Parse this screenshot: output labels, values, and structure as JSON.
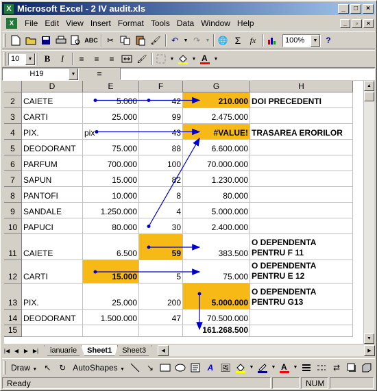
{
  "window": {
    "title": "Microsoft Excel - 2 IV audit.xls",
    "app_icon": "X"
  },
  "menu": [
    "File",
    "Edit",
    "View",
    "Insert",
    "Format",
    "Tools",
    "Data",
    "Window",
    "Help"
  ],
  "toolbar_standard": {
    "zoom": "100%",
    "icons": [
      "new-icon",
      "open-icon",
      "save-icon",
      "print-icon",
      "print-preview-icon",
      "spelling-icon",
      "cut-icon",
      "copy-icon",
      "paste-icon",
      "format-painter-icon",
      "undo-icon",
      "redo-icon",
      "hyperlink-icon",
      "autosum-icon",
      "function-icon",
      "chart-wizard-icon"
    ]
  },
  "toolbar_formatting": {
    "font_size": "10",
    "bold": "B",
    "italic": "I"
  },
  "formula_bar": {
    "name_box": "H19",
    "equals": "=",
    "content": ""
  },
  "grid": {
    "columns": [
      {
        "key": "D",
        "label": "D"
      },
      {
        "key": "E",
        "label": "E"
      },
      {
        "key": "F",
        "label": "F"
      },
      {
        "key": "G",
        "label": "G"
      },
      {
        "key": "H",
        "label": "H"
      }
    ],
    "rows": [
      {
        "num": "2",
        "D": "CAIETE",
        "E": "5.000",
        "F": "42",
        "G": "210.000",
        "H": "DOI PRECEDENTI"
      },
      {
        "num": "3",
        "D": "CARTI",
        "E": "25.000",
        "F": "99",
        "G": "2.475.000",
        "H": ""
      },
      {
        "num": "4",
        "D": "PIX.",
        "E": "pix",
        "F": "43",
        "G": "#VALUE!",
        "H": "TRASAREA ERORILOR"
      },
      {
        "num": "5",
        "D": "DEODORANT",
        "E": "75.000",
        "F": "88",
        "G": "6.600.000",
        "H": ""
      },
      {
        "num": "6",
        "D": "PARFUM",
        "E": "700.000",
        "F": "100",
        "G": "70.000.000",
        "H": ""
      },
      {
        "num": "7",
        "D": "SAPUN",
        "E": "15.000",
        "F": "82",
        "G": "1.230.000",
        "H": ""
      },
      {
        "num": "8",
        "D": "PANTOFI",
        "E": "10.000",
        "F": "8",
        "G": "80.000",
        "H": ""
      },
      {
        "num": "9",
        "D": "SANDALE",
        "E": "1.250.000",
        "F": "4",
        "G": "5.000.000",
        "H": ""
      },
      {
        "num": "10",
        "D": "PAPUCI",
        "E": "80.000",
        "F": "30",
        "G": "2.400.000",
        "H": ""
      },
      {
        "num": "11",
        "D": "CAIETE",
        "E": "6.500",
        "F": "59",
        "G": "383.500",
        "H": "O DEPENDENTA PENTRU F 11"
      },
      {
        "num": "12",
        "D": "CARTI",
        "E": "15.000",
        "F": "5",
        "G": "75.000",
        "H": "O DEPENDENTA PENTRU E 12"
      },
      {
        "num": "13",
        "D": "PIX.",
        "E": "25.000",
        "F": "200",
        "G": "5.000.000",
        "H": "O DEPENDENTA PENTRU G13"
      },
      {
        "num": "14",
        "D": "DEODORANT",
        "E": "1.500.000",
        "F": "47",
        "G": "70.500.000",
        "H": ""
      },
      {
        "num": "15",
        "D": "",
        "E": "",
        "F": "",
        "G": "161.268.500",
        "H": ""
      }
    ],
    "highlight_color": "#f7b916",
    "arrow_color": "#0000cc"
  },
  "sheet_tabs": [
    "ianuarie",
    "Sheet1",
    "Sheet3"
  ],
  "active_sheet": "Sheet1",
  "drawing_toolbar": {
    "draw_label": "Draw",
    "autoshapes_label": "AutoShapes"
  },
  "status": {
    "ready": "Ready",
    "num": "NUM"
  }
}
